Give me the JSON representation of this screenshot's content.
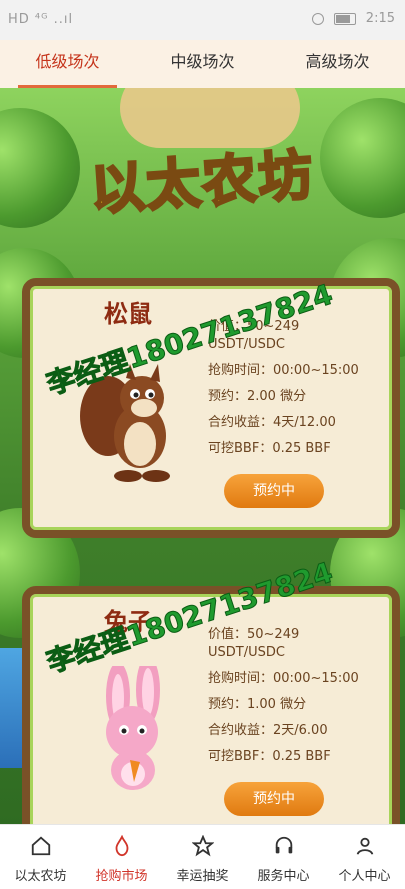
{
  "status": {
    "left": "HD ⁴ᴳ ..ıl",
    "time": "2:15"
  },
  "tabs": [
    {
      "label": "低级场次"
    },
    {
      "label": "中级场次"
    },
    {
      "label": "高级场次"
    }
  ],
  "logo": {
    "title": "以太农坊"
  },
  "watermark": "李经理18027137824",
  "cards": [
    {
      "name": "松鼠",
      "price": "价值：50~249",
      "price2": "USDT/USDC",
      "time": "抢购时间：00:00~15:00",
      "reserve": "预约：2.00 微分",
      "contract": "合约收益：4天/12.00",
      "mine": "可挖BBF：0.25 BBF",
      "button": "预约中"
    },
    {
      "name": "兔子",
      "price": "价值：50~249",
      "price2": "USDT/USDC",
      "time": "抢购时间：00:00~15:00",
      "reserve": "预约：1.00 微分",
      "contract": "合约收益：2天/6.00",
      "mine": "可挖BBF：0.25 BBF",
      "button": "预约中"
    }
  ],
  "nav": [
    {
      "label": "以太农坊",
      "icon": "home-icon"
    },
    {
      "label": "抢购市场",
      "icon": "flame-icon"
    },
    {
      "label": "幸运抽奖",
      "icon": "star-icon"
    },
    {
      "label": "服务中心",
      "icon": "headset-icon"
    },
    {
      "label": "个人中心",
      "icon": "user-icon"
    }
  ]
}
